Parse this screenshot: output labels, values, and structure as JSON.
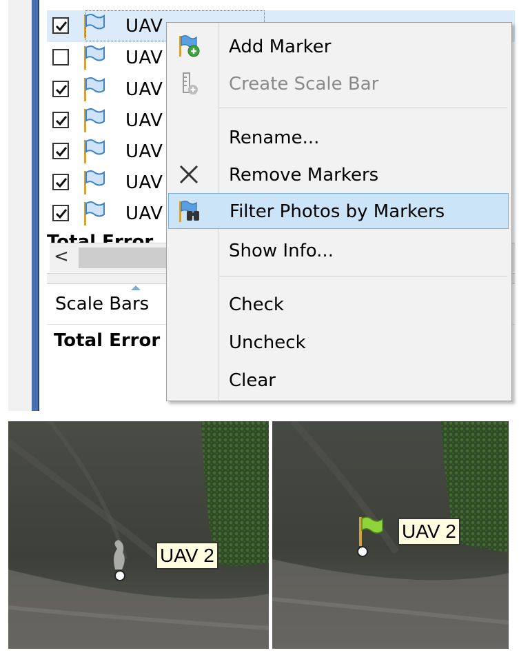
{
  "markers_table": {
    "rows": [
      {
        "label": "UAV",
        "checked": true,
        "selected": true
      },
      {
        "label": "UAV",
        "checked": false,
        "selected": false
      },
      {
        "label": "UAV",
        "checked": true,
        "selected": false
      },
      {
        "label": "UAV",
        "checked": true,
        "selected": false
      },
      {
        "label": "UAV",
        "checked": true,
        "selected": false
      },
      {
        "label": "UAV",
        "checked": true,
        "selected": false
      },
      {
        "label": "UAV",
        "checked": true,
        "selected": false
      }
    ],
    "total_error_label": "Total Error",
    "scroll_left_glyph": "<"
  },
  "scale_bars_table": {
    "header": "Scale Bars",
    "total_error_label": "Total Error"
  },
  "context_menu": {
    "items": [
      {
        "label": "Add Marker",
        "icon": "add-marker-icon",
        "enabled": true
      },
      {
        "label": "Create Scale Bar",
        "icon": "scale-bar-icon",
        "enabled": false
      },
      {
        "label": "Rename...",
        "enabled": true
      },
      {
        "label": "Remove Markers",
        "icon": "remove-icon",
        "enabled": true
      },
      {
        "label": "Filter Photos by Markers",
        "icon": "filter-photos-icon",
        "enabled": true,
        "highlighted": true
      },
      {
        "label": "Show Info...",
        "enabled": true
      },
      {
        "label": "Check",
        "enabled": true
      },
      {
        "label": "Uncheck",
        "enabled": true
      },
      {
        "label": "Clear",
        "enabled": true
      }
    ]
  },
  "photos": {
    "left": {
      "marker_label": "UAV 2",
      "state": "unplaced"
    },
    "right": {
      "marker_label": "UAV 2",
      "state": "placed"
    }
  },
  "colors": {
    "accent_blue": "#4a6fb0",
    "selection_bg": "#dcebfa",
    "menu_highlight": "#cce4f7",
    "flag_blue": "#5aa0e0",
    "flag_green": "#8fd43a",
    "flag_pole": "#d4a23a"
  }
}
